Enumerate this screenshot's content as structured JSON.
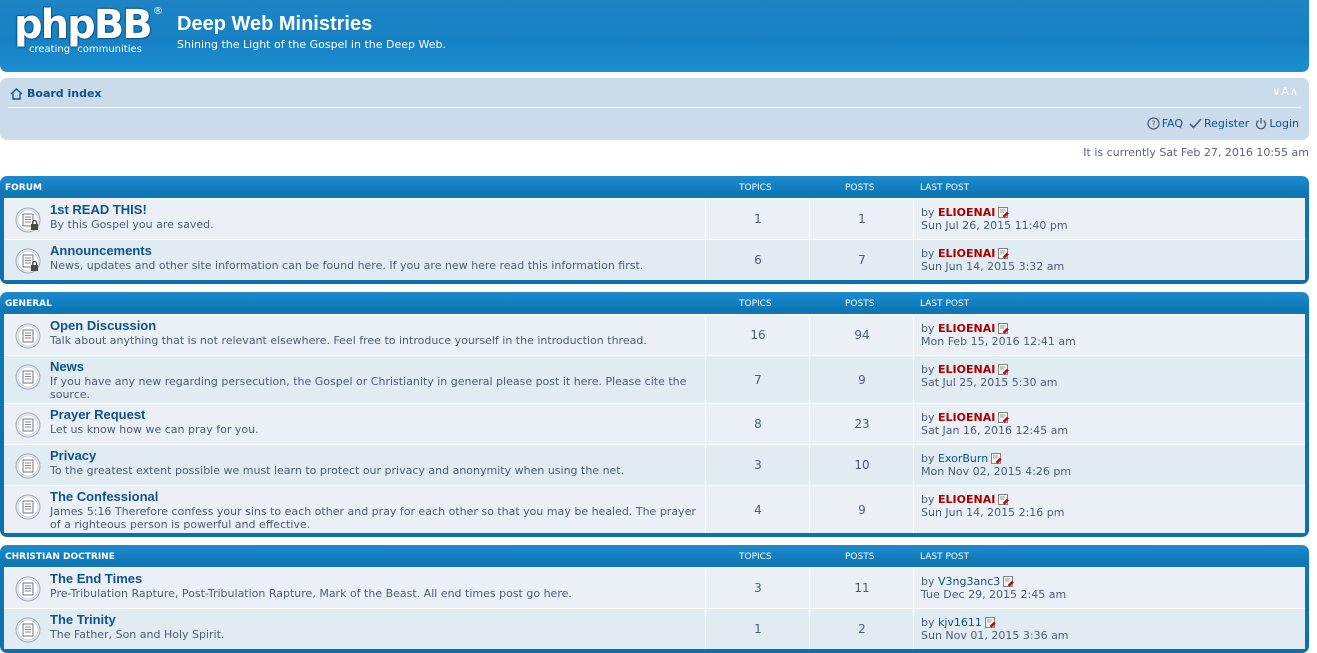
{
  "logo": {
    "wordmark": "phpBB",
    "registered": "®",
    "tagline": "creating communities"
  },
  "site": {
    "title": "Deep Web Ministries",
    "description": "Shining the Light of the Gospel in the Deep Web."
  },
  "navbar": {
    "board_index": "Board index",
    "font_size_toggle": "∨A∧",
    "faq": "FAQ",
    "register": "Register",
    "login": "Login"
  },
  "current_time": "It is currently Sat Feb 27, 2016 10:55 am",
  "colors": {
    "header_blue": "#1681c4",
    "nav_bg": "#cadceb",
    "row_bg": "#eaf0f6",
    "row_alt_bg": "#e1ebf2",
    "admin_red": "#aa0000",
    "link_blue": "#105289"
  },
  "categories": [
    {
      "title": "Forum",
      "col_topics": "Topics",
      "col_posts": "Posts",
      "col_last": "Last post",
      "forums": [
        {
          "name": "1st READ THIS!",
          "desc": "By this Gospel you are saved.",
          "topics": "1",
          "posts": "1",
          "by": "by",
          "user": "ELIOENAI",
          "admin": true,
          "date": "Sun Jul 26, 2015 11:40 pm",
          "locked": true
        },
        {
          "name": "Announcements",
          "desc": "News, updates and other site information can be found here. If you are new here read this information first.",
          "topics": "6",
          "posts": "7",
          "by": "by",
          "user": "ELIOENAI",
          "admin": true,
          "date": "Sun Jun 14, 2015 3:32 am",
          "locked": true
        }
      ]
    },
    {
      "title": "General",
      "col_topics": "Topics",
      "col_posts": "Posts",
      "col_last": "Last post",
      "forums": [
        {
          "name": "Open Discussion",
          "desc": "Talk about anything that is not relevant elsewhere. Feel free to introduce yourself in the introduction thread.",
          "topics": "16",
          "posts": "94",
          "by": "by",
          "user": "ELIOENAI",
          "admin": true,
          "date": "Mon Feb 15, 2016 12:41 am"
        },
        {
          "name": "News",
          "desc": "If you have any new regarding persecution, the Gospel or Christianity in general please post it here. Please cite the source.",
          "topics": "7",
          "posts": "9",
          "by": "by",
          "user": "ELIOENAI",
          "admin": true,
          "date": "Sat Jul 25, 2015 5:30 am",
          "tall": true
        },
        {
          "name": "Prayer Request",
          "desc": "Let us know how we can pray for you.",
          "topics": "8",
          "posts": "23",
          "by": "by",
          "user": "ELIOENAI",
          "admin": true,
          "date": "Sat Jan 16, 2016 12:45 am"
        },
        {
          "name": "Privacy",
          "desc": "To the greatest extent possible we must learn to protect our privacy and anonymity when using the net.",
          "topics": "3",
          "posts": "10",
          "by": "by",
          "user": "ExorBurn",
          "admin": false,
          "date": "Mon Nov 02, 2015 4:26 pm"
        },
        {
          "name": "The Confessional",
          "desc": "James 5:16 Therefore confess your sins to each other and pray for each other so that you may be healed. The prayer of a righteous person is powerful and effective.",
          "topics": "4",
          "posts": "9",
          "by": "by",
          "user": "ELIOENAI",
          "admin": true,
          "date": "Sun Jun 14, 2015 2:16 pm",
          "tall": true
        }
      ]
    },
    {
      "title": "Christian Doctrine",
      "col_topics": "Topics",
      "col_posts": "Posts",
      "col_last": "Last post",
      "forums": [
        {
          "name": "The End Times",
          "desc": "Pre-Tribulation Rapture, Post-Tribulation Rapture, Mark of the Beast. All end times post go here.",
          "topics": "3",
          "posts": "11",
          "by": "by",
          "user": "V3ng3anc3",
          "admin": false,
          "date": "Tue Dec 29, 2015 2:45 am"
        },
        {
          "name": "The Trinity",
          "desc": "The Father, Son and Holy Spirit.",
          "topics": "1",
          "posts": "2",
          "by": "by",
          "user": "kjv1611",
          "admin": false,
          "date": "Sun Nov 01, 2015 3:36 am"
        }
      ]
    }
  ]
}
